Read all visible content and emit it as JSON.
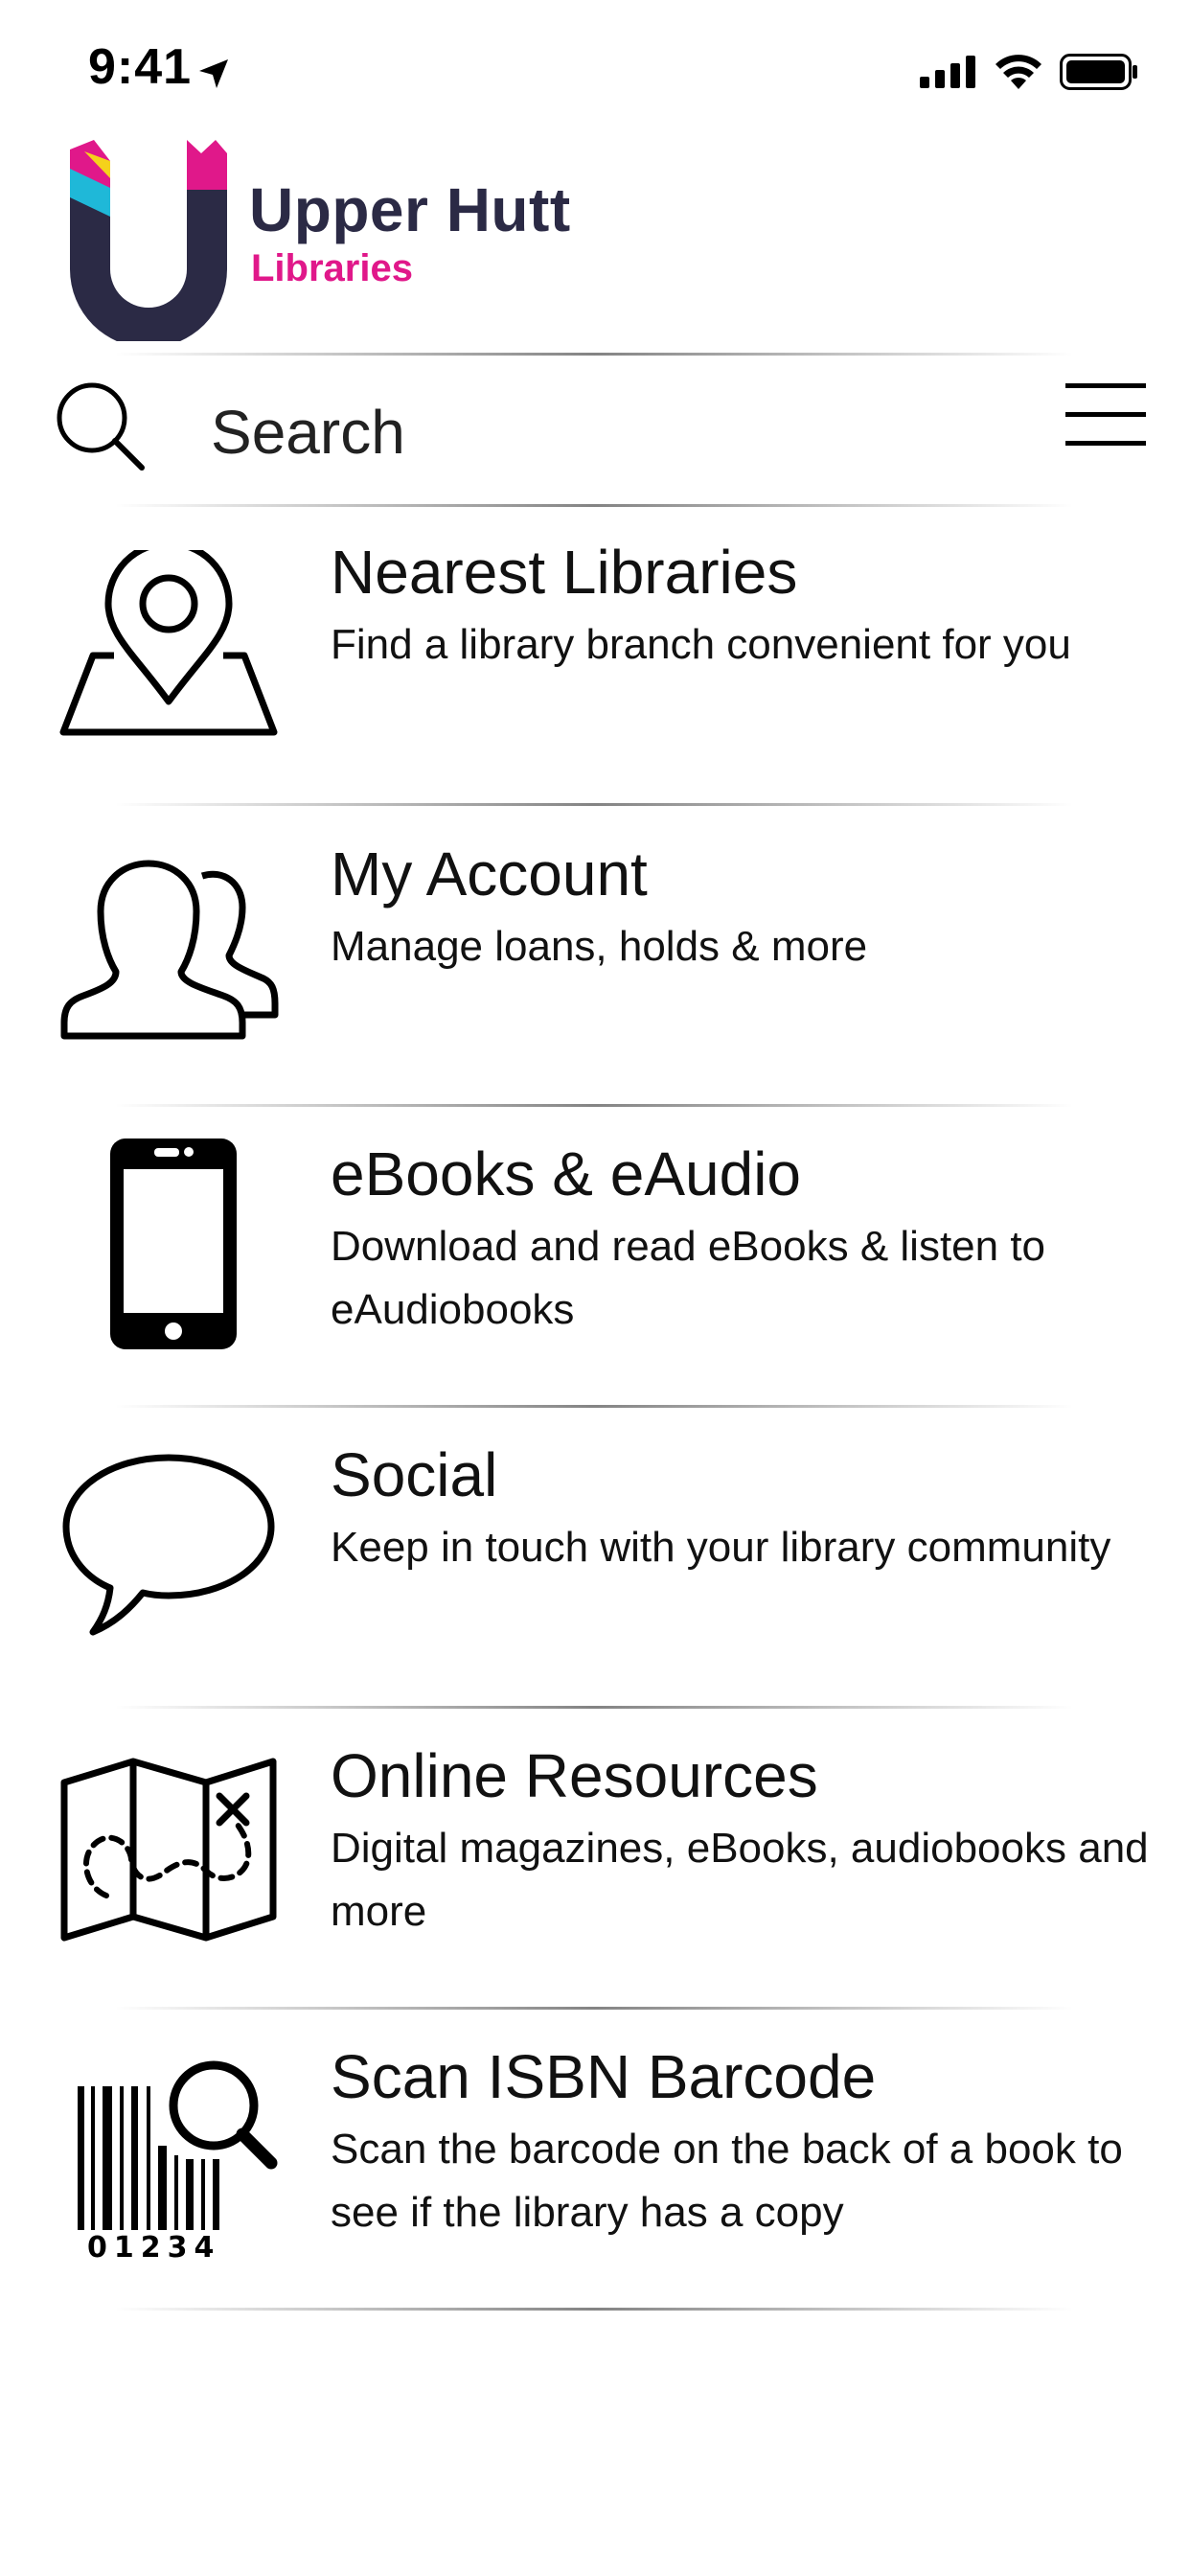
{
  "status_bar": {
    "time": "9:41"
  },
  "logo": {
    "name": "Upper Hutt",
    "subtitle": "Libraries"
  },
  "search": {
    "placeholder": "Search"
  },
  "menu_items": [
    {
      "title": "Nearest Libraries",
      "description": "Find a library branch convenient for you",
      "icon": "map-pin-icon"
    },
    {
      "title": "My Account",
      "description": "Manage loans, holds & more",
      "icon": "users-icon"
    },
    {
      "title": "eBooks & eAudio",
      "description": "Download and read eBooks & listen to eAudiobooks",
      "icon": "smartphone-icon"
    },
    {
      "title": "Social",
      "description": "Keep in touch with your library community",
      "icon": "speech-bubble-icon"
    },
    {
      "title": "Online Resources",
      "description": "Digital magazines, eBooks, audiobooks and more",
      "icon": "treasure-map-icon"
    },
    {
      "title": "Scan ISBN Barcode",
      "description": "Scan the barcode on the back of a book to see if the library has a copy",
      "icon": "barcode-search-icon",
      "icon_digits": "01234"
    }
  ],
  "colors": {
    "brand_navy": "#2b2a45",
    "brand_magenta": "#e0188a",
    "brand_cyan": "#1fb8d8",
    "brand_yellow": "#f5d21b"
  }
}
